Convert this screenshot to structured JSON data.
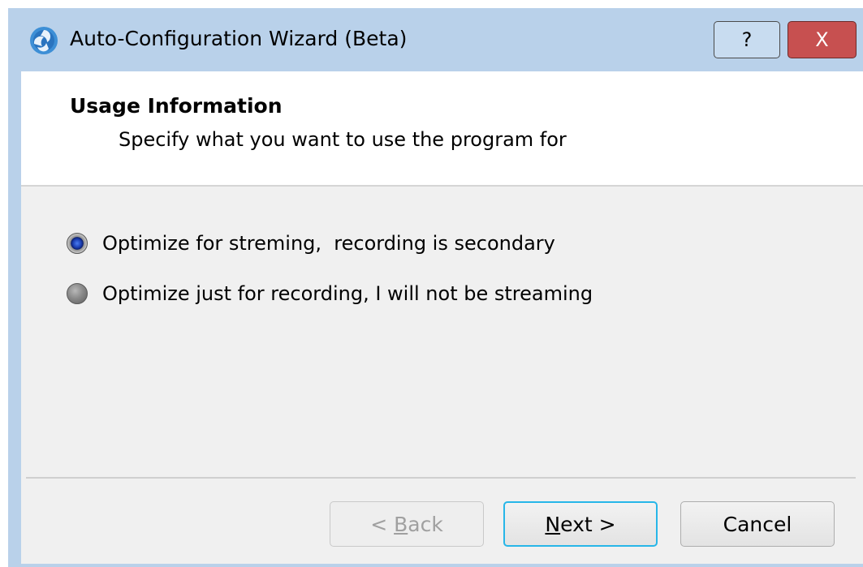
{
  "window": {
    "title": "Auto-Configuration Wizard (Beta)",
    "help_label": "?",
    "close_label": "X"
  },
  "header": {
    "heading": "Usage Information",
    "subheading": "Specify what you want to use the program for"
  },
  "options": [
    {
      "label": "Optimize for streming,  recording is secondary",
      "checked": true
    },
    {
      "label": "Optimize just for recording, I will not be streaming",
      "checked": false
    }
  ],
  "buttons": {
    "back_prefix": "< ",
    "back_mnemonic": "B",
    "back_rest": "ack",
    "next_mnemonic": "N",
    "next_rest": "ext >",
    "cancel": "Cancel"
  },
  "colors": {
    "frame": "#b9d1ea",
    "close": "#c75050",
    "focus": "#27b6e8"
  }
}
